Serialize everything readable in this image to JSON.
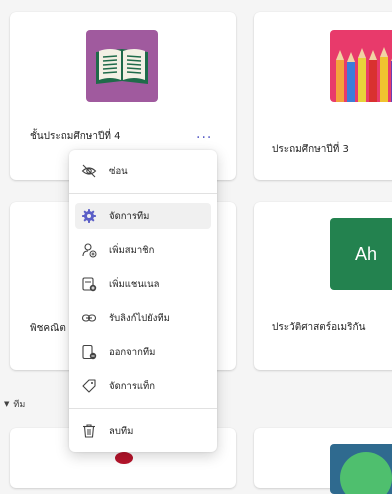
{
  "cards": [
    {
      "title": "ชั้นประถมศึกษาปีที่ 4",
      "more_label": "···",
      "thumb_color": "#a05a9e"
    },
    {
      "title": "ประถมศึกษาปีที่ 3",
      "thumb_color": "#e83a6b"
    },
    {
      "title": "พิชคณิต"
    },
    {
      "title": "ประวัติศาสตร์อเมริกัน",
      "thumb_text": "Ah",
      "thumb_color": "#23824f"
    }
  ],
  "section": {
    "label": "ทีม"
  },
  "menu": {
    "items": [
      {
        "label": "ซ่อน",
        "icon": "eye-off-icon"
      },
      {
        "label": "จัดการทีม",
        "icon": "gear-icon"
      },
      {
        "label": "เพิ่มสมาชิก",
        "icon": "add-person-icon"
      },
      {
        "label": "เพิ่มแชนเนล",
        "icon": "add-channel-icon"
      },
      {
        "label": "รับลิงก์ไปยังทีม",
        "icon": "link-icon"
      },
      {
        "label": "ออกจากทีม",
        "icon": "leave-icon"
      },
      {
        "label": "จัดการแท็ก",
        "icon": "tag-icon"
      },
      {
        "label": "ลบทีม",
        "icon": "trash-icon"
      }
    ]
  },
  "colors": {
    "accent": "#5b5fc7",
    "gear": "#5b5fc7"
  }
}
